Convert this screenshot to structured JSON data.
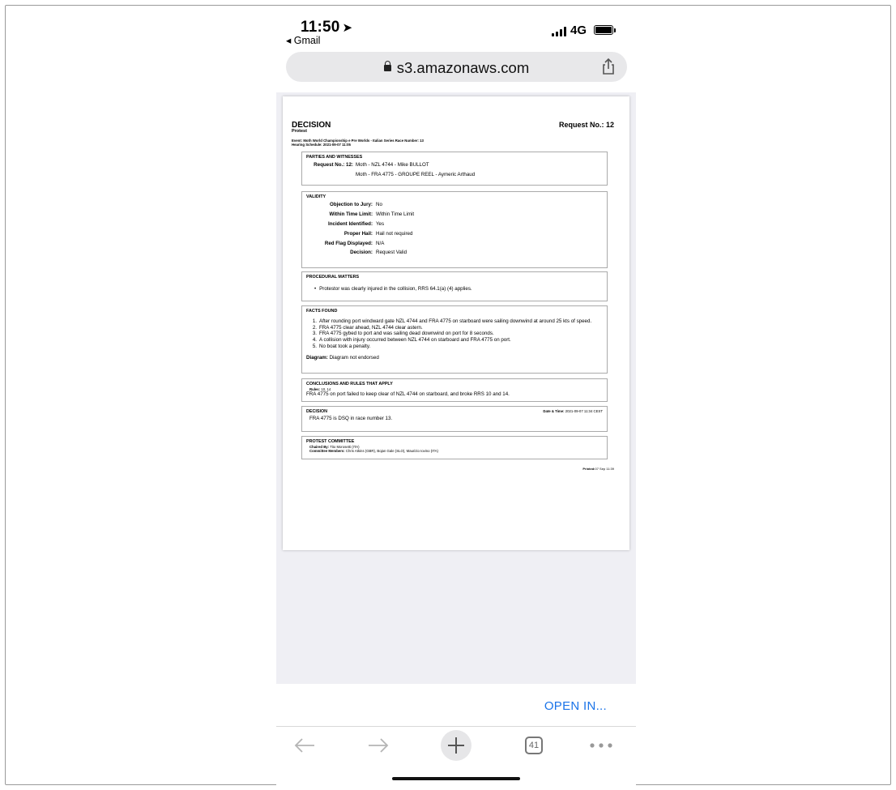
{
  "status_bar": {
    "time": "11:50",
    "location_arrow": "➤",
    "back_app": "◂ Gmail",
    "network": "4G"
  },
  "browser": {
    "url": "s3.amazonaws.com",
    "open_in_label": "OPEN IN...",
    "tab_count": "41"
  },
  "document": {
    "title": "DECISION",
    "subtitle": "Protest",
    "request_no_label": "Request No.: 12",
    "event_line": "Event: Moth World Championship e Pre Worlds - Italian Series   Race Number: 13",
    "hearing_line": "Hearing Schedule: 2021-09-07 11:05",
    "parties": {
      "heading": "PARTIES AND WITNESSES",
      "request_key": "Request No.: 12:",
      "party1": "Moth - NZL 4744 - Mike BULLOT",
      "party2": "Moth - FRA 4775 - GROUPE REEL - Aymeric Arthaud"
    },
    "validity": {
      "heading": "VALIDITY",
      "rows": [
        {
          "k": "Objection to Jury:",
          "v": "No"
        },
        {
          "k": "Within Time Limit:",
          "v": "Within Time Limit"
        },
        {
          "k": "Incident Identified:",
          "v": "Yes"
        },
        {
          "k": "Proper Hail:",
          "v": "Hail not required"
        },
        {
          "k": "Red Flag Displayed:",
          "v": "N/A"
        },
        {
          "k": "Decision:",
          "v": "Request Valid"
        }
      ]
    },
    "procedural": {
      "heading": "PROCEDURAL MATTERS",
      "item": "Protestor was clearly injured in the collision, RRS 64.1(a) (4) applies."
    },
    "facts": {
      "heading": "FACTS FOUND",
      "items": [
        {
          "n": "1.",
          "t": "After rounding port windward gate NZL 4744 and FRA 4775 on starboard were sailing downwind at around 25 kts of speed."
        },
        {
          "n": "2.",
          "t": "FRA 4775 clear ahead, NZL 4744 clear astern."
        },
        {
          "n": "3.",
          "t": "FRA 4775 gybed to port and was sailing dead downwind on port for 8 seconds."
        },
        {
          "n": "4.",
          "t": "A collision with injury occurred between NZL 4744 on starboard and FRA 4775 on port."
        },
        {
          "n": "5.",
          "t": "No boat took a penalty."
        }
      ],
      "diagram_key": "Diagram:",
      "diagram_value": "Diagram not endorsed"
    },
    "conclusions": {
      "heading": "CONCLUSIONS AND RULES THAT APPLY",
      "rules_key": "Rules:",
      "rules_value": "10, 14",
      "text": "FRA 4775 on port failed to keep clear of NZL 4744 on starboard, and broke RRS 10 and 14."
    },
    "decision": {
      "heading": "DECISION",
      "datetime_key": "Date & Time:",
      "datetime_value": "2021-09-07 11:34 CEST",
      "text": "FRA 4775 is DSQ in race number 13."
    },
    "committee": {
      "heading": "PROTEST COMMITTEE",
      "chaired_key": "Chaired By:",
      "chaired_value": "Tito Morosetti (ITA)",
      "members_key": "Committee Members:",
      "members_value": "Chris Atkins (GBR), Bojan Gale (SLO), Maurizio Iovino (ITA)"
    },
    "printed_key": "Printed:",
    "printed_value": "07 Sep 11:39"
  },
  "icons": [
    "share-icon",
    "lock-icon",
    "back-arrow-icon",
    "forward-arrow-icon",
    "plus-icon",
    "tabs-icon",
    "more-icon"
  ],
  "colors": {
    "link": "#1a73e8",
    "viewer_bg": "#efeff4"
  }
}
